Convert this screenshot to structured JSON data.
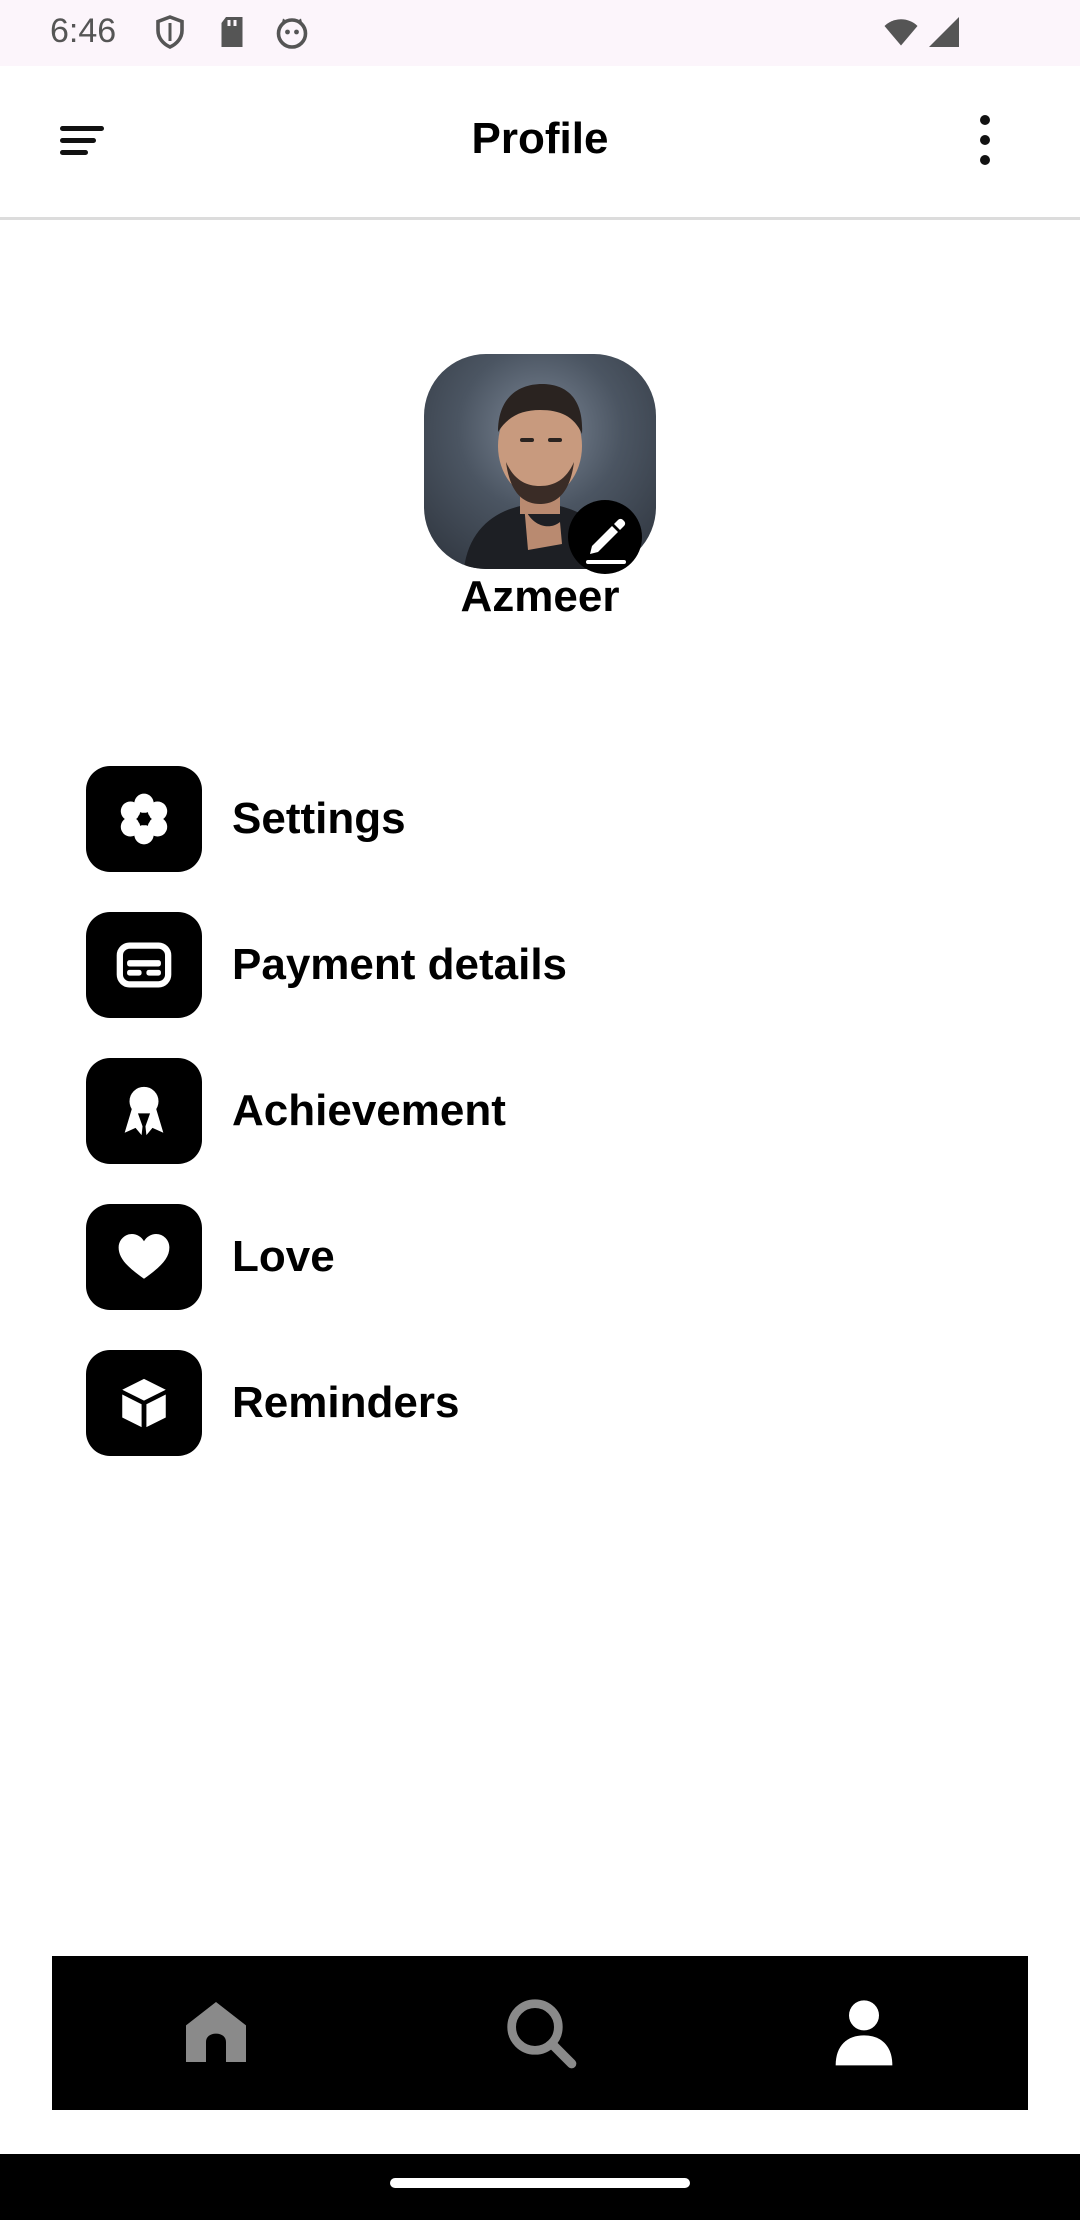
{
  "status_bar": {
    "time": "6:46",
    "icons": [
      "shield-icon",
      "sd-card-icon",
      "cat-face-icon",
      "wifi-icon",
      "signal-icon"
    ]
  },
  "app_bar": {
    "title": "Profile",
    "left_icon": "menu-icon",
    "right_icon": "more-vert-icon"
  },
  "profile": {
    "name": "Azmeer",
    "avatar_icon": "avatar-photo",
    "edit_icon": "edit-pencil-icon"
  },
  "menu": {
    "items": [
      {
        "label": "Settings",
        "icon": "gear-icon"
      },
      {
        "label": "Payment details",
        "icon": "credit-card-icon"
      },
      {
        "label": "Achievement",
        "icon": "award-ribbon-icon"
      },
      {
        "label": "Love",
        "icon": "heart-icon"
      },
      {
        "label": "Reminders",
        "icon": "box-icon"
      }
    ]
  },
  "bottom_nav": {
    "items": [
      {
        "icon": "home-icon",
        "active": false
      },
      {
        "icon": "search-icon",
        "active": false
      },
      {
        "icon": "person-icon",
        "active": true
      }
    ]
  },
  "colors": {
    "status_bar_bg": "#fcf5fb",
    "icon_tile_bg": "#000000",
    "nav_bg": "#000000",
    "nav_active": "#ffffff",
    "nav_inactive": "#8a8a8a"
  }
}
